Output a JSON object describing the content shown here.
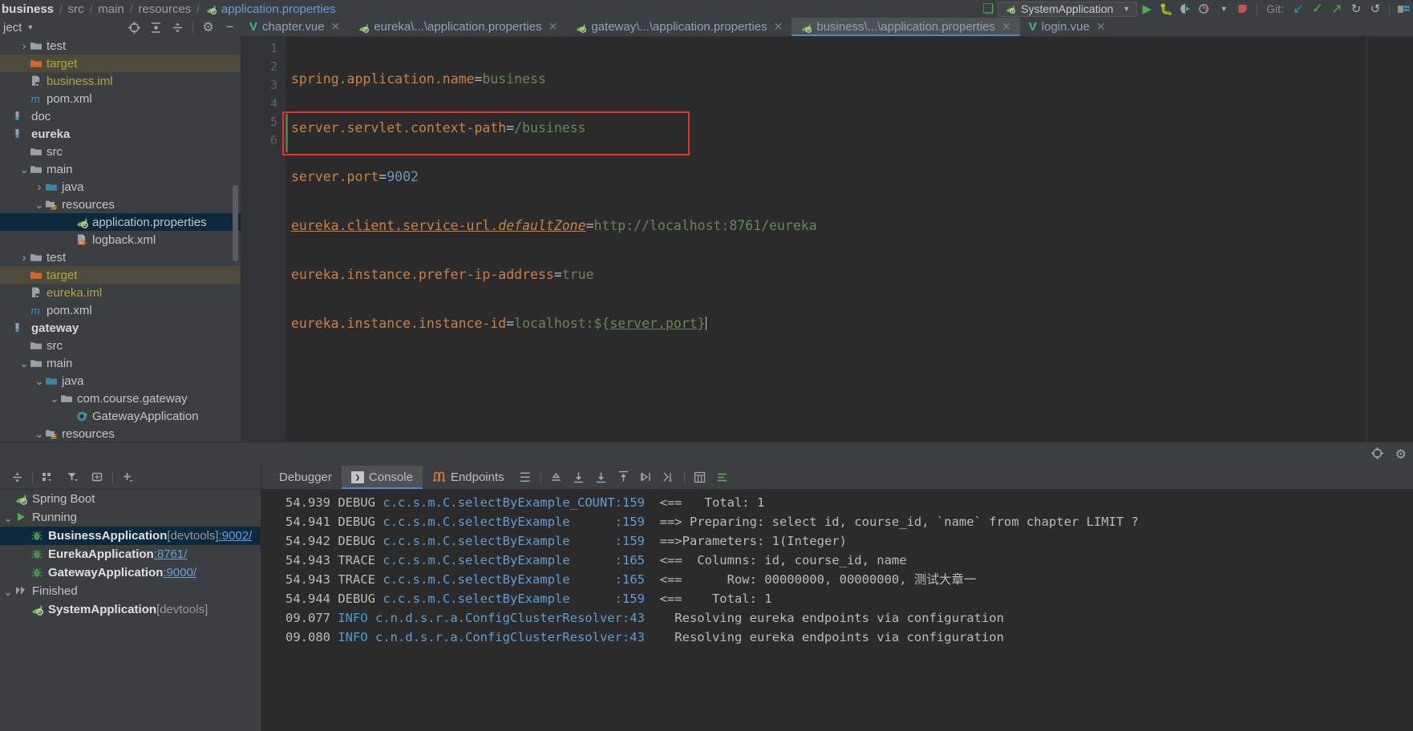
{
  "breadcrumb": {
    "items": [
      "business",
      "src",
      "main",
      "resources",
      "application.properties"
    ]
  },
  "toolbar": {
    "run_config": "SystemApplication",
    "git_label": "Git:",
    "icons": [
      "run-icon",
      "debug-icon",
      "run-with-coverage-icon",
      "profile-icon",
      "dropdown-icon",
      "stop-icon",
      "git-update-icon",
      "git-commit-icon",
      "git-push-icon",
      "git-history-icon",
      "git-rollback-icon",
      "layout-icon"
    ]
  },
  "project_toolbar": {
    "title": "ject",
    "icons": [
      "locate-icon",
      "expand-all-icon",
      "collapse-all-icon",
      "settings-icon",
      "hide-icon"
    ]
  },
  "editor_tabs": [
    {
      "label": "chapter.vue",
      "icon": "vue-icon",
      "active": false
    },
    {
      "label": "eureka\\...\\application.properties",
      "icon": "spring-icon",
      "active": false
    },
    {
      "label": "gateway\\...\\application.properties",
      "icon": "spring-icon",
      "active": false
    },
    {
      "label": "business\\...\\application.properties",
      "icon": "spring-icon",
      "active": true
    },
    {
      "label": "login.vue",
      "icon": "vue-icon",
      "active": false
    }
  ],
  "tree": [
    {
      "label": "test",
      "indent": 1,
      "arrow": "right",
      "icon": "folder-gray",
      "style": "normal",
      "sel": ""
    },
    {
      "label": "target",
      "indent": 1,
      "arrow": "none",
      "icon": "folder-orange",
      "style": "orange",
      "sel": "target"
    },
    {
      "label": "business.iml",
      "indent": 1,
      "arrow": "none",
      "icon": "iml",
      "style": "orange",
      "sel": ""
    },
    {
      "label": "pom.xml",
      "indent": 1,
      "arrow": "none",
      "icon": "maven",
      "style": "normal",
      "sel": ""
    },
    {
      "label": "doc",
      "indent": 0,
      "arrow": "none",
      "icon": "module",
      "style": "normal",
      "sel": ""
    },
    {
      "label": "eureka",
      "indent": 0,
      "arrow": "none",
      "icon": "module",
      "style": "bold",
      "sel": ""
    },
    {
      "label": "src",
      "indent": 1,
      "arrow": "none",
      "icon": "folder-gray",
      "style": "normal",
      "sel": ""
    },
    {
      "label": "main",
      "indent": 1,
      "arrow": "down",
      "icon": "folder-gray",
      "style": "normal",
      "sel": ""
    },
    {
      "label": "java",
      "indent": 2,
      "arrow": "right",
      "icon": "folder-blue",
      "style": "normal",
      "sel": ""
    },
    {
      "label": "resources",
      "indent": 2,
      "arrow": "down",
      "icon": "folder-res",
      "style": "normal",
      "sel": ""
    },
    {
      "label": "application.properties",
      "indent": 4,
      "arrow": "none",
      "icon": "spring",
      "style": "normal",
      "sel": "blue"
    },
    {
      "label": "logback.xml",
      "indent": 4,
      "arrow": "none",
      "icon": "xml",
      "style": "normal",
      "sel": ""
    },
    {
      "label": "test",
      "indent": 1,
      "arrow": "right",
      "icon": "folder-gray",
      "style": "normal",
      "sel": ""
    },
    {
      "label": "target",
      "indent": 1,
      "arrow": "none",
      "icon": "folder-orange",
      "style": "orange",
      "sel": "target"
    },
    {
      "label": "eureka.iml",
      "indent": 1,
      "arrow": "none",
      "icon": "iml",
      "style": "orange",
      "sel": ""
    },
    {
      "label": "pom.xml",
      "indent": 1,
      "arrow": "none",
      "icon": "maven",
      "style": "normal",
      "sel": ""
    },
    {
      "label": "gateway",
      "indent": 0,
      "arrow": "none",
      "icon": "module",
      "style": "bold",
      "sel": ""
    },
    {
      "label": "src",
      "indent": 1,
      "arrow": "none",
      "icon": "folder-gray",
      "style": "normal",
      "sel": ""
    },
    {
      "label": "main",
      "indent": 1,
      "arrow": "down",
      "icon": "folder-gray",
      "style": "normal",
      "sel": ""
    },
    {
      "label": "java",
      "indent": 2,
      "arrow": "down",
      "icon": "folder-blue",
      "style": "normal",
      "sel": ""
    },
    {
      "label": "com.course.gateway",
      "indent": 3,
      "arrow": "down",
      "icon": "package",
      "style": "normal",
      "sel": ""
    },
    {
      "label": "GatewayApplication",
      "indent": 4,
      "arrow": "none",
      "icon": "springclass",
      "style": "normal",
      "sel": ""
    },
    {
      "label": "resources",
      "indent": 2,
      "arrow": "down",
      "icon": "folder-res",
      "style": "normal",
      "sel": ""
    }
  ],
  "editor": {
    "line_numbers": [
      "1",
      "2",
      "3",
      "4",
      "5",
      "6"
    ],
    "lines": [
      {
        "key": "spring.application.name",
        "value": "business",
        "kind": "str"
      },
      {
        "key": "server.servlet.context-path",
        "value": "/business",
        "kind": "str"
      },
      {
        "key": "server.port",
        "value": "9002",
        "kind": "num"
      },
      {
        "key": "eureka.client.service-url.",
        "key_italic": "defaultZone",
        "value": "http://localhost:8761/eureka",
        "kind": "str"
      },
      {
        "key": "eureka.instance.prefer-ip-address",
        "value": "true",
        "kind": "str"
      },
      {
        "key": "eureka.instance.instance-id",
        "value": "localhost:${server.port}",
        "kind": "ref"
      }
    ]
  },
  "run_dashboard": {
    "toolbar_icons": [
      "collapse-icon",
      "group-icon",
      "filter-icon",
      "add-tab-icon",
      "plus-icon"
    ],
    "nodes": [
      {
        "label": "Spring Boot",
        "detail": "",
        "port": "",
        "indent": 0,
        "arrow": "none",
        "icon": "spring",
        "bold": false,
        "sel": false
      },
      {
        "label": "Running",
        "detail": "",
        "port": "",
        "indent": 0,
        "arrow": "down",
        "icon": "play",
        "bold": false,
        "sel": false
      },
      {
        "label": "BusinessApplication",
        "detail": "[devtools]",
        "port": ":9002/",
        "indent": 1,
        "arrow": "none",
        "icon": "bug",
        "bold": true,
        "sel": true
      },
      {
        "label": "EurekaApplication",
        "detail": "",
        "port": ":8761/",
        "indent": 1,
        "arrow": "none",
        "icon": "bug",
        "bold": true,
        "sel": false
      },
      {
        "label": "GatewayApplication",
        "detail": "",
        "port": ":9000/",
        "indent": 1,
        "arrow": "none",
        "icon": "bug",
        "bold": true,
        "sel": false
      },
      {
        "label": "Finished",
        "detail": "",
        "port": "",
        "indent": 0,
        "arrow": "down",
        "icon": "finished",
        "bold": false,
        "sel": false
      },
      {
        "label": "SystemApplication",
        "detail": "[devtools]",
        "port": "",
        "indent": 1,
        "arrow": "none",
        "icon": "spring",
        "bold": true,
        "sel": false
      }
    ]
  },
  "console": {
    "tabs": [
      {
        "label": "Debugger",
        "icon": "",
        "active": false
      },
      {
        "label": "Console",
        "icon": "console-icon",
        "active": true
      },
      {
        "label": "Endpoints",
        "icon": "endpoints-icon",
        "active": false
      }
    ],
    "toolbar_icons": [
      "menu-icon",
      "step-out-icon",
      "step-over-icon",
      "step-into-icon",
      "force-step-icon",
      "run-to-cursor-icon",
      "drop-frame-icon",
      "evaluate-icon",
      "settings-icon"
    ],
    "log_lines": [
      {
        "time": "54.939",
        "level": "DEBUG",
        "logger": "c.c.s.m.C.selectByExample_COUNT",
        "line": ":159",
        "pad": "",
        "arrow": "<==",
        "msg": "   Total: 1"
      },
      {
        "time": "54.941",
        "level": "DEBUG",
        "logger": "c.c.s.m.C.selectByExample",
        "line": ":159",
        "pad": "      ",
        "arrow": "==>",
        "msg": " Preparing: select id, course_id, `name` from chapter LIMIT ?"
      },
      {
        "time": "54.942",
        "level": "DEBUG",
        "logger": "c.c.s.m.C.selectByExample",
        "line": ":159",
        "pad": "      ",
        "arrow": "==>",
        "msg": "Parameters: 1(Integer)"
      },
      {
        "time": "54.943",
        "level": "TRACE",
        "logger": "c.c.s.m.C.selectByExample",
        "line": ":165",
        "pad": "      ",
        "arrow": "<==",
        "msg": "  Columns: id, course_id, name"
      },
      {
        "time": "54.943",
        "level": "TRACE",
        "logger": "c.c.s.m.C.selectByExample",
        "line": ":165",
        "pad": "      ",
        "arrow": "<==",
        "msg": "      Row: 00000000, 00000000, 测试大章一"
      },
      {
        "time": "54.944",
        "level": "DEBUG",
        "logger": "c.c.s.m.C.selectByExample",
        "line": ":159",
        "pad": "      ",
        "arrow": "<==",
        "msg": "    Total: 1"
      },
      {
        "time": "09.077",
        "level": "INFO",
        "logger": "c.n.d.s.r.a.ConfigClusterResolver",
        "line": ":43",
        "pad": "",
        "arrow": "",
        "msg": "  Resolving eureka endpoints via configuration"
      },
      {
        "time": "09.080",
        "level": "INFO",
        "logger": "c.n.d.s.r.a.ConfigClusterResolver",
        "line": ":43",
        "pad": "",
        "arrow": "",
        "msg": "  Resolving eureka endpoints via configuration"
      }
    ]
  },
  "colors": {
    "accent": "#4a88c7",
    "selection": "#0d293e",
    "target_highlight": "#4e4a3c",
    "red_box": "#ee3322",
    "editor_bg": "#2b2b2b",
    "panel_bg": "#3c3f41"
  }
}
